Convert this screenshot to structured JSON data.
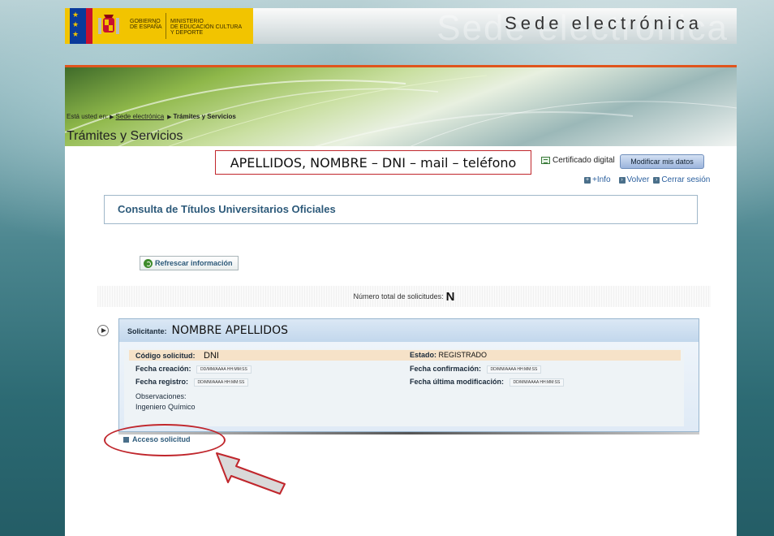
{
  "header": {
    "gov_name": "GOBIERNO\nDE ESPAÑA",
    "ministry_name": "MINISTERIO\nDE EDUCACIÓN CULTURA\nY DEPORTE",
    "site_title": "Sede electrónica",
    "site_title_ghost": "Sede electrónica"
  },
  "breadcrumb": {
    "prefix": "Está usted en:",
    "link": "Sede electrónica",
    "current": "Trámites y Servicios"
  },
  "page_title": "Trámites y Servicios",
  "user": {
    "info": "APELLIDOS, NOMBRE – DNI – mail – teléfono",
    "cert_label": "Certificado digital",
    "modify_button": "Modificar mis datos",
    "info_link": "+Info",
    "back_link": "Volver",
    "logout_link": "Cerrar sesión"
  },
  "consulta_title": "Consulta de Títulos Universitarios Oficiales",
  "refresh_button": "Refrescar información",
  "total": {
    "label": "Número total de solicitudes:",
    "value": "N"
  },
  "solicitud": {
    "applicant_label": "Solicitante:",
    "applicant_name": "NOMBRE APELLIDOS",
    "codigo_label": "Código solicitud:",
    "codigo_value": "DNI",
    "estado_label": "Estado:",
    "estado_value": "REGISTRADO",
    "fecha_creacion_label": "Fecha creación:",
    "fecha_creacion_value": "DD/MM/AAAA HH:MM:SS",
    "fecha_confirmacion_label": "Fecha confirmación:",
    "fecha_confirmacion_value": "DD/MM/AAAA HH:MM:SS",
    "fecha_registro_label": "Fecha registro:",
    "fecha_registro_value": "DD/MM/AAAA HH:MM:SS",
    "fecha_ultima_label": "Fecha última modificación:",
    "fecha_ultima_value": "DD/MM/AAAA HH:MM:SS",
    "observaciones_label": "Observaciones:",
    "observaciones_value": "Ingeniero Químico"
  },
  "acceso_link": "Acceso solicitud",
  "colors": {
    "accent_red": "#c0262c",
    "link_blue": "#2d5a7a",
    "gov_yellow": "#f2c400"
  }
}
